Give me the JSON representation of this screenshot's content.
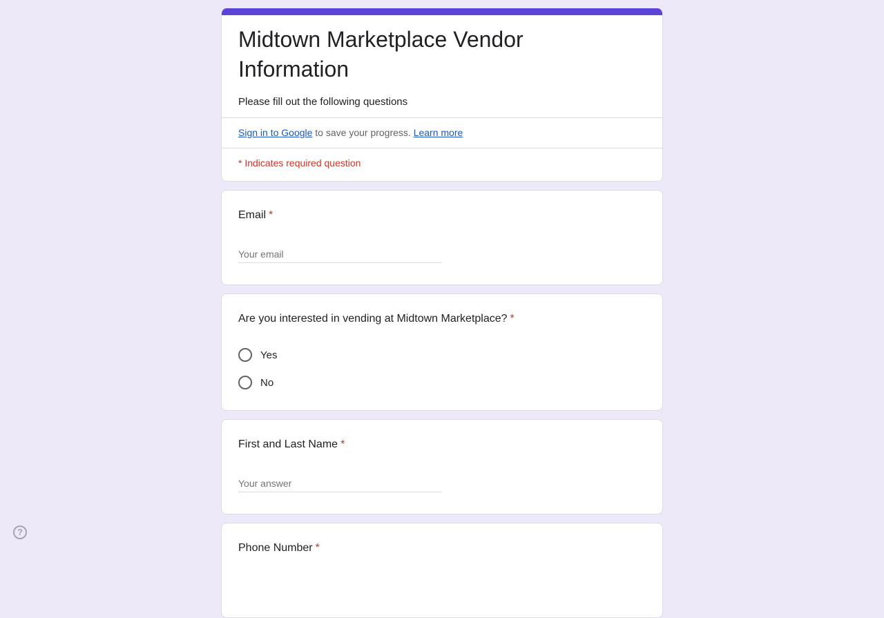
{
  "form": {
    "title": "Midtown Marketplace Vendor Information",
    "description": "Please fill out the following questions",
    "signin_link": "Sign in to Google",
    "signin_text": " to save your progress. ",
    "learn_more": "Learn more",
    "required_note": "* Indicates required question"
  },
  "questions": {
    "email": {
      "title": "Email",
      "star": "*",
      "placeholder": "Your email"
    },
    "interest": {
      "title": "Are you interested in vending at Midtown Marketplace?",
      "star": "*",
      "options": [
        "Yes",
        "No"
      ]
    },
    "name": {
      "title": "First and Last Name",
      "star": "*",
      "placeholder": "Your answer"
    },
    "phone": {
      "title": "Phone Number",
      "star": "*"
    }
  },
  "help_icon_glyph": "?",
  "colors": {
    "accent": "#5b45d9",
    "background": "#ede9f9",
    "required": "#d93025",
    "link": "#1a56c4"
  }
}
